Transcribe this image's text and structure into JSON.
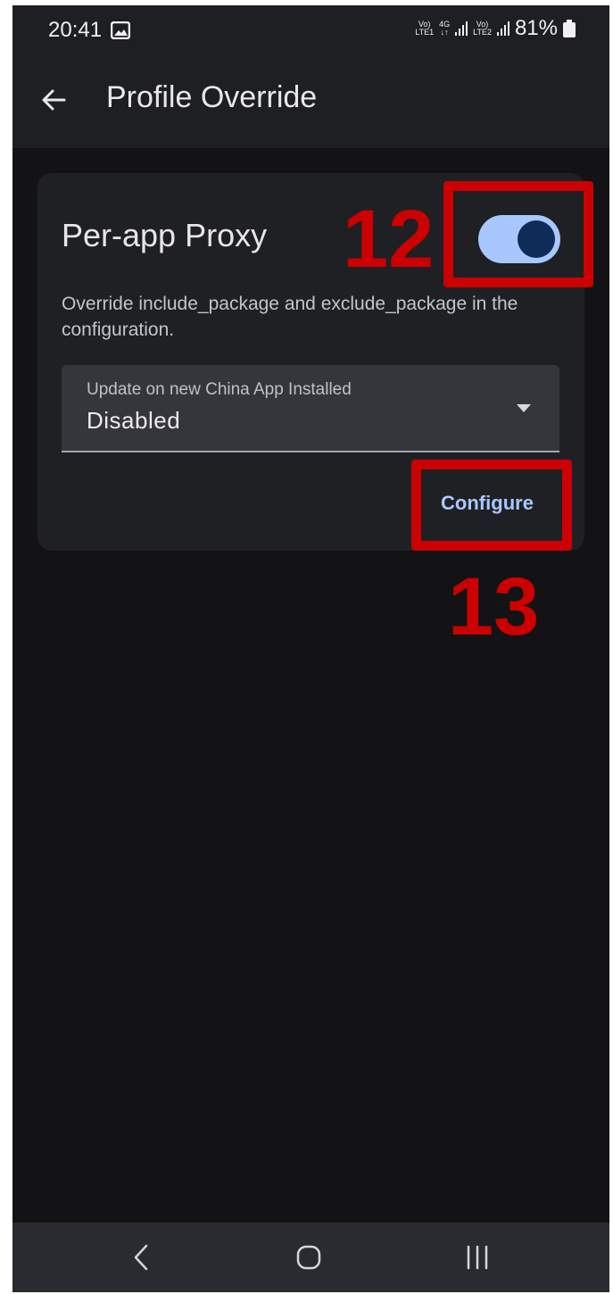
{
  "status_bar": {
    "time": "20:41",
    "sim1_label_top": "Vo)",
    "sim1_label_bottom": "LTE1",
    "net_label_top": "4G",
    "net_label_bottom": "↓↑",
    "sim2_label_top": "Vo)",
    "sim2_label_bottom": "LTE2",
    "battery": "81%"
  },
  "app_bar": {
    "title": "Profile Override"
  },
  "per_app_proxy": {
    "title": "Per-app Proxy",
    "enabled": true,
    "description": "Override include_package and exclude_package in the configuration.",
    "dropdown": {
      "label": "Update on new China App Installed",
      "value": "Disabled"
    },
    "configure_label": "Configure"
  },
  "annotations": {
    "toggle_step": "12",
    "configure_step": "13",
    "color": "#cc0000"
  },
  "colors": {
    "background": "#131316",
    "card": "#1f2024",
    "accent": "#a9c7ff",
    "toggle_thumb": "#0f2b58"
  }
}
